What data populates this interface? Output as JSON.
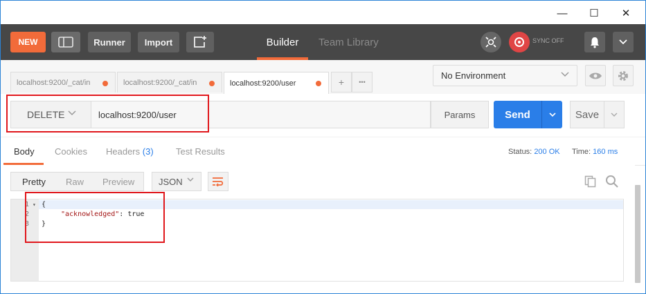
{
  "window": {
    "minimize": "—",
    "maximize": "☐",
    "close": "✕"
  },
  "toolbar": {
    "new_label": "NEW",
    "runner_label": "Runner",
    "import_label": "Import",
    "tab_builder": "Builder",
    "tab_team_library": "Team Library",
    "sync_text": "SYNC OFF"
  },
  "request_tabs": [
    {
      "label": "localhost:9200/_cat/in"
    },
    {
      "label": "localhost:9200/_cat/in"
    },
    {
      "label": "localhost:9200/user"
    }
  ],
  "tab_actions": {
    "add": "+",
    "more": "•••"
  },
  "environment": {
    "selected": "No Environment"
  },
  "request": {
    "method": "DELETE",
    "url": "localhost:9200/user",
    "params_label": "Params",
    "send_label": "Send",
    "save_label": "Save"
  },
  "response_tabs": {
    "body": "Body",
    "cookies": "Cookies",
    "headers": "Headers",
    "headers_count": "(3)",
    "test_results": "Test Results"
  },
  "status": {
    "status_label": "Status:",
    "status_value": "200 OK",
    "time_label": "Time:",
    "time_value": "160 ms"
  },
  "view_modes": {
    "pretty": "Pretty",
    "raw": "Raw",
    "preview": "Preview",
    "format": "JSON"
  },
  "code": {
    "line_numbers": [
      "1",
      "2",
      "3"
    ],
    "line1": "{",
    "line2_key": "\"acknowledged\"",
    "line2_rest": ": true",
    "line3": "}"
  },
  "colors": {
    "accent": "#f26b3a",
    "send": "#2a7ee8",
    "highlight_box": "#e0161b"
  },
  "icons": [
    "sidebar-icon",
    "new-window-icon",
    "interceptor-icon",
    "sync-icon",
    "bell-icon",
    "chevron-down-icon",
    "eye-icon",
    "gear-icon",
    "wrap-icon",
    "copy-icon",
    "search-icon"
  ]
}
